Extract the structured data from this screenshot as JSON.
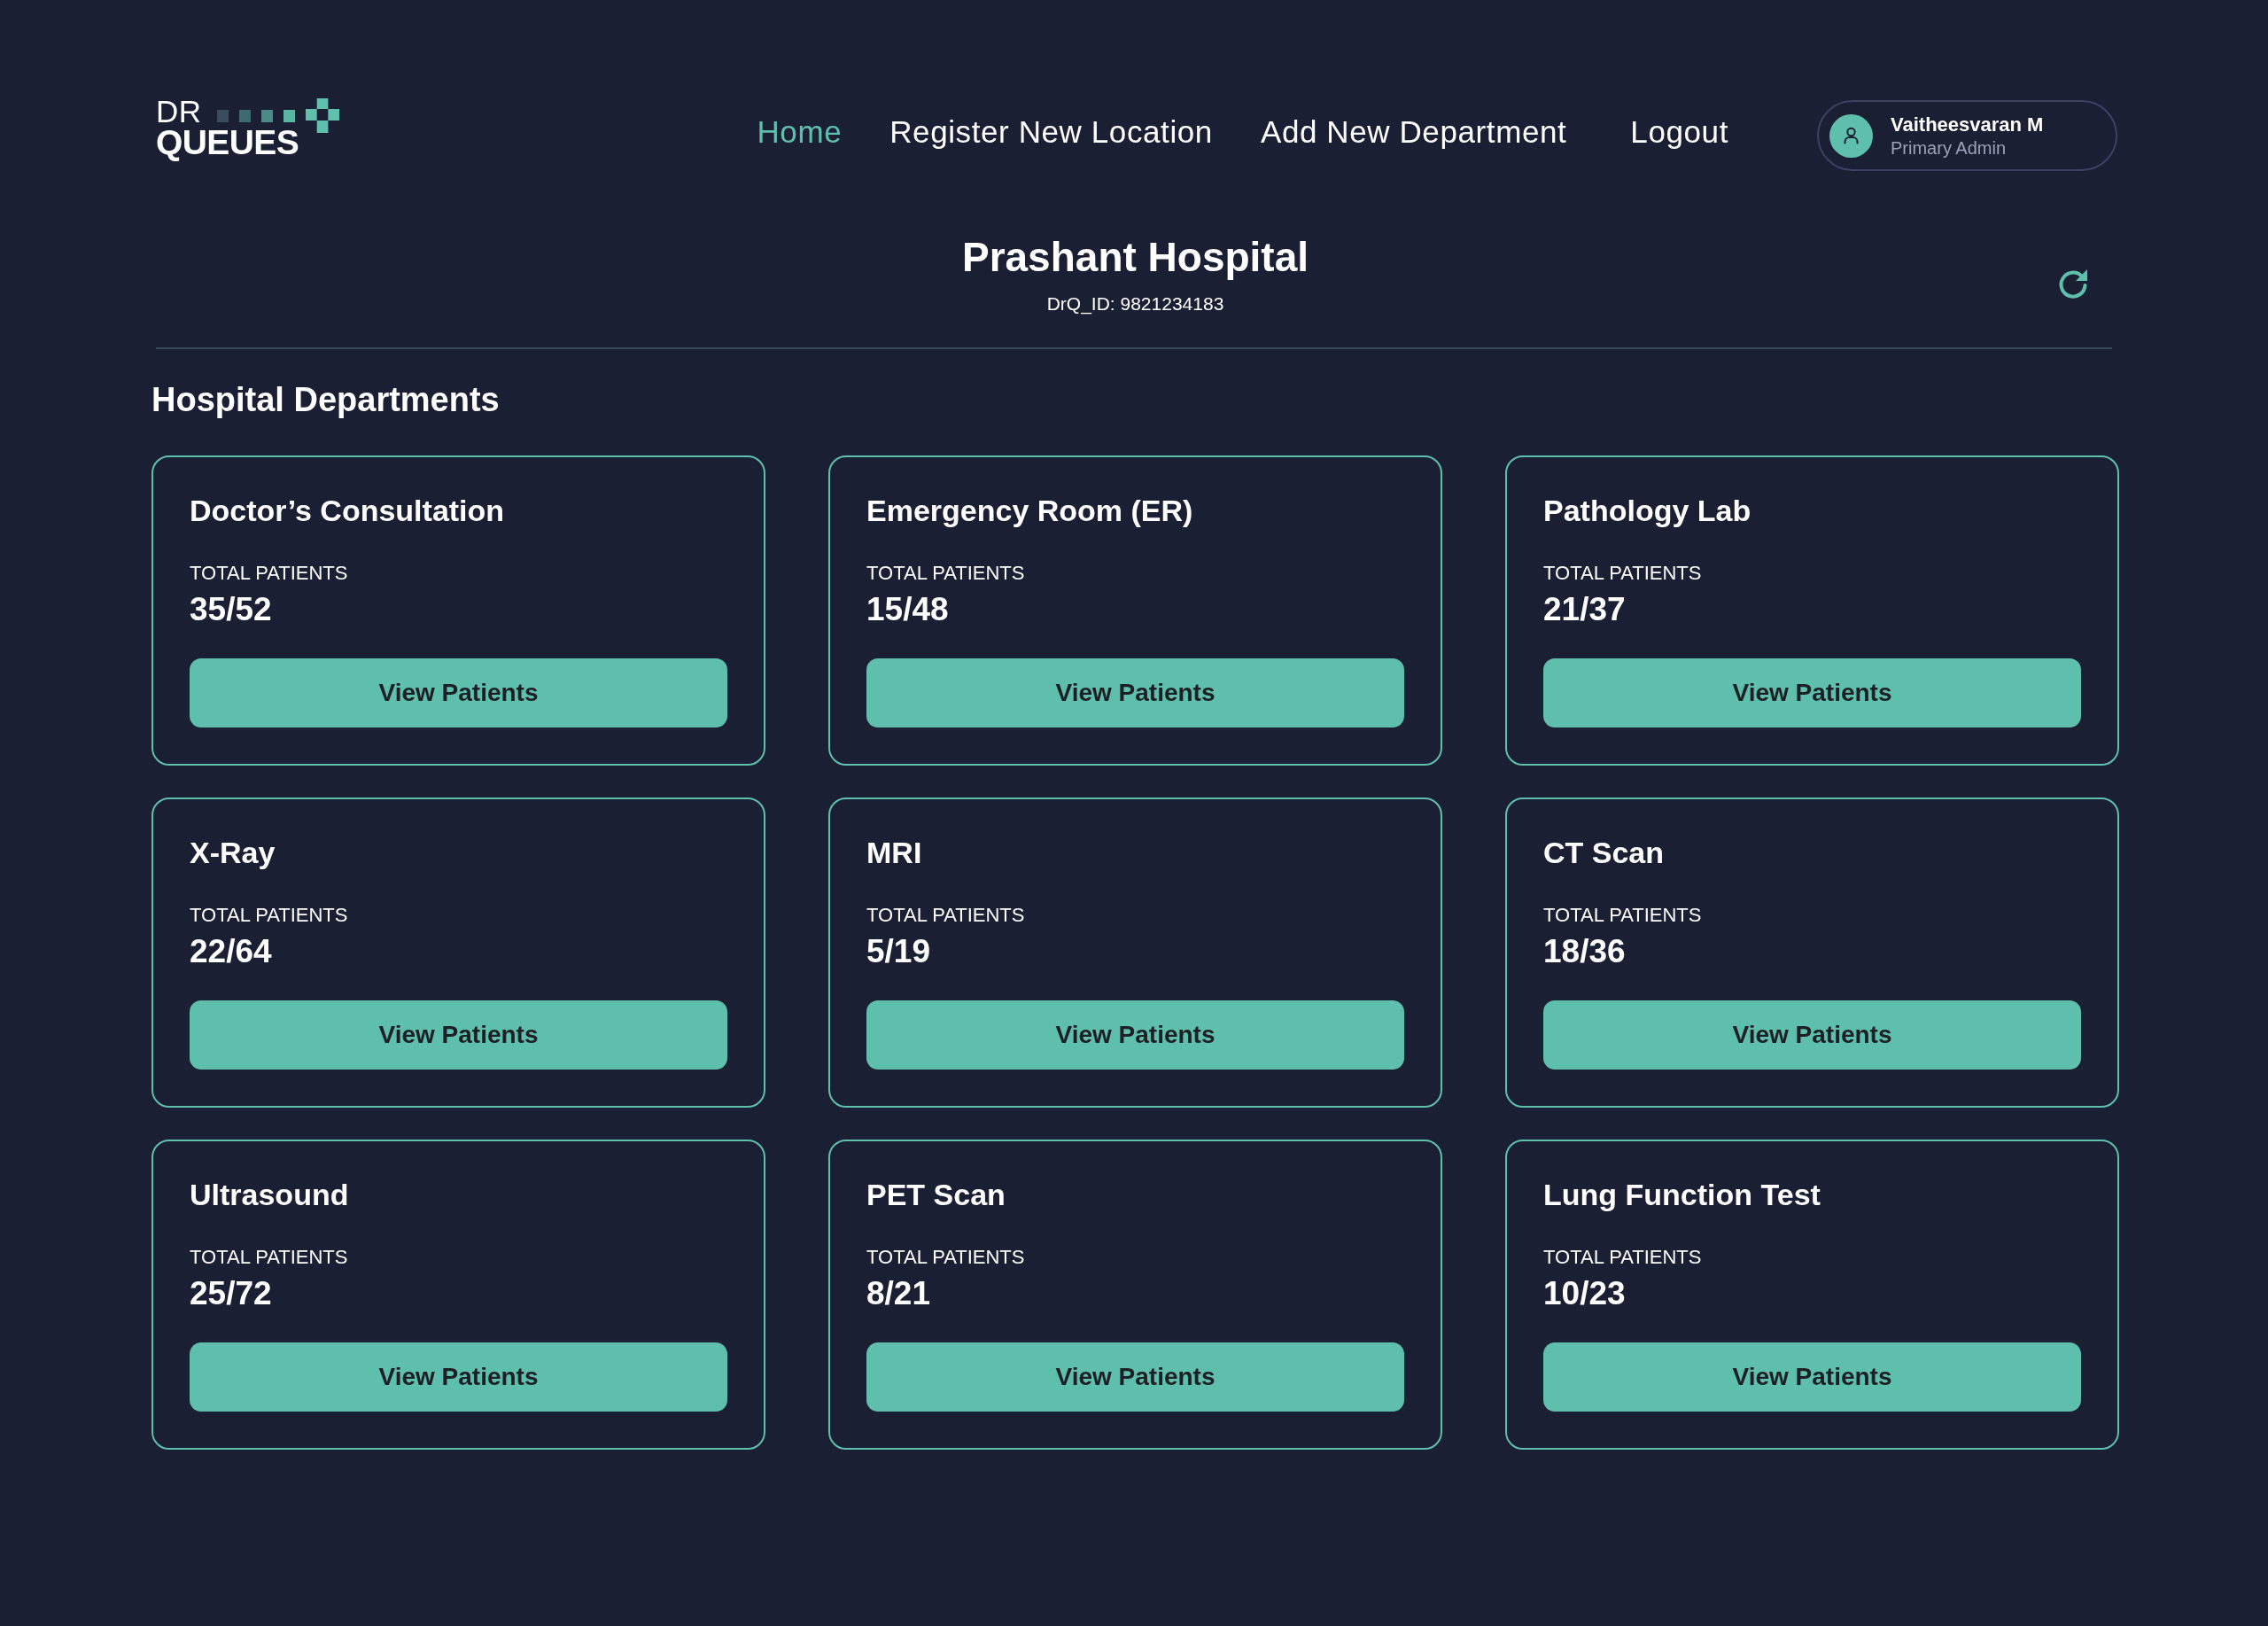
{
  "logo": {
    "line_1": "DR",
    "line_2": "QUEUES"
  },
  "nav": [
    {
      "label": "Home",
      "selected": true
    },
    {
      "label": "Register New Location",
      "selected": false
    },
    {
      "label": "Add New Department",
      "selected": false
    },
    {
      "label": "Logout",
      "selected": false
    }
  ],
  "user": {
    "name": "Vaitheesvaran M",
    "role": "Primary Admin"
  },
  "hospital": {
    "name": "Prashant Hospital",
    "id": "DrQ_ID: 9821234183"
  },
  "section_title": "Hospital Departments",
  "departments": [
    {
      "name": "Doctor’s Consultation",
      "metric_label": "TOTAL PATIENTS",
      "count": "35/52",
      "button": "View Patients"
    },
    {
      "name": "Emergency Room (ER)",
      "metric_label": "TOTAL PATIENTS",
      "count": "15/48",
      "button": "View Patients"
    },
    {
      "name": "Pathology Lab",
      "metric_label": "TOTAL PATIENTS",
      "count": "21/37",
      "button": "View Patients"
    },
    {
      "name": "X-Ray",
      "metric_label": "TOTAL PATIENTS",
      "count": "22/64",
      "button": "View Patients"
    },
    {
      "name": "MRI",
      "metric_label": "TOTAL PATIENTS",
      "count": "5/19",
      "button": "View Patients"
    },
    {
      "name": "CT Scan",
      "metric_label": "TOTAL PATIENTS",
      "count": "18/36",
      "button": "View Patients"
    },
    {
      "name": "Ultrasound",
      "metric_label": "TOTAL PATIENTS",
      "count": "25/72",
      "button": "View Patients"
    },
    {
      "name": "PET Scan",
      "metric_label": "TOTAL PATIENTS",
      "count": "8/21",
      "button": "View Patients"
    },
    {
      "name": "Lung Function Test",
      "metric_label": "TOTAL PATIENTS",
      "count": "10/23",
      "button": "View Patients"
    }
  ]
}
